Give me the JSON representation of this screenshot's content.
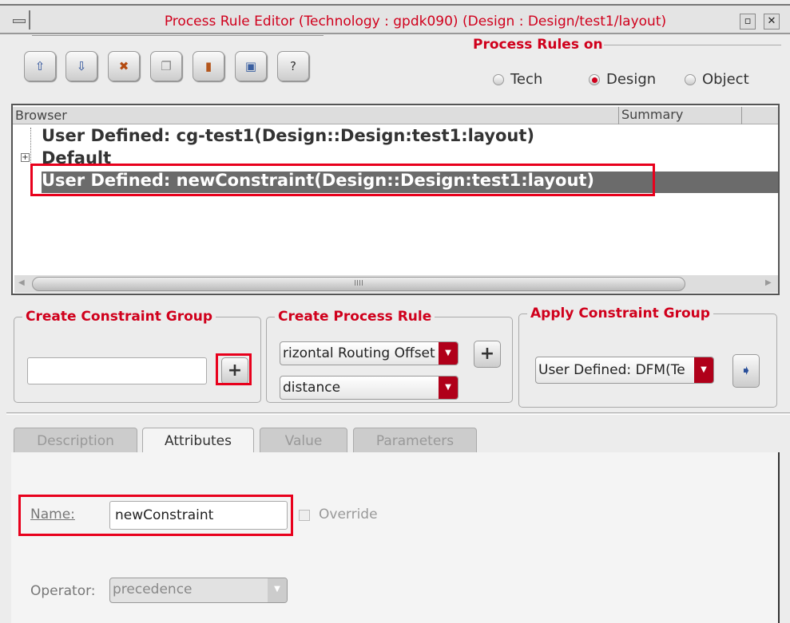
{
  "window": {
    "title": "Process Rule Editor (Technology : gpdk090) (Design : Design/test1/layout)"
  },
  "toolbar": {
    "buttons": [
      {
        "name": "move-up",
        "icon": "arrow-up-icon",
        "label": "⇧"
      },
      {
        "name": "move-down",
        "icon": "arrow-down-icon",
        "label": "⇩"
      },
      {
        "name": "delete",
        "icon": "delete-icon",
        "label": "✖"
      },
      {
        "name": "copy",
        "icon": "copy-icon",
        "label": "❐"
      },
      {
        "name": "paste",
        "icon": "paste-icon",
        "label": "▮"
      },
      {
        "name": "save",
        "icon": "save-icon",
        "label": "▣"
      },
      {
        "name": "help",
        "icon": "help-icon",
        "label": "?"
      }
    ]
  },
  "process_rules_on": {
    "label": "Process Rules on",
    "options": [
      "Tech",
      "Design",
      "Object"
    ],
    "selected": "Design"
  },
  "browser": {
    "columns": [
      "Browser",
      "Summary"
    ],
    "rows": [
      {
        "label": "User Defined: cg-test1(Design::Design:test1:layout)",
        "expandable": false,
        "selected": false
      },
      {
        "label": "Default",
        "expandable": true,
        "selected": false
      },
      {
        "label": "User Defined: newConstraint(Design::Design:test1:layout)",
        "expandable": false,
        "selected": true
      }
    ],
    "scroll_grip": "IIII"
  },
  "create_constraint_group": {
    "label": "Create Constraint Group",
    "input_value": "",
    "add_label": "+"
  },
  "create_process_rule": {
    "label": "Create Process Rule",
    "rule_value": "rizontal Routing Offset",
    "type_value": "distance",
    "add_label": "+"
  },
  "apply_constraint_group": {
    "label": "Apply Constraint Group",
    "value": "User Defined: DFM(Te",
    "apply_label": "➧"
  },
  "tabs": [
    {
      "label": "Description"
    },
    {
      "label": "Attributes"
    },
    {
      "label": "Value"
    },
    {
      "label": "Parameters"
    }
  ],
  "active_tab": "Attributes",
  "attributes": {
    "name_label": "Name:",
    "name_value": "newConstraint",
    "override_label": "Override",
    "operator_label": "Operator:",
    "operator_value": "precedence"
  },
  "colors": {
    "accent": "#d0001c",
    "highlight_box": "#e8001c",
    "selection": "#6b6b6b"
  }
}
